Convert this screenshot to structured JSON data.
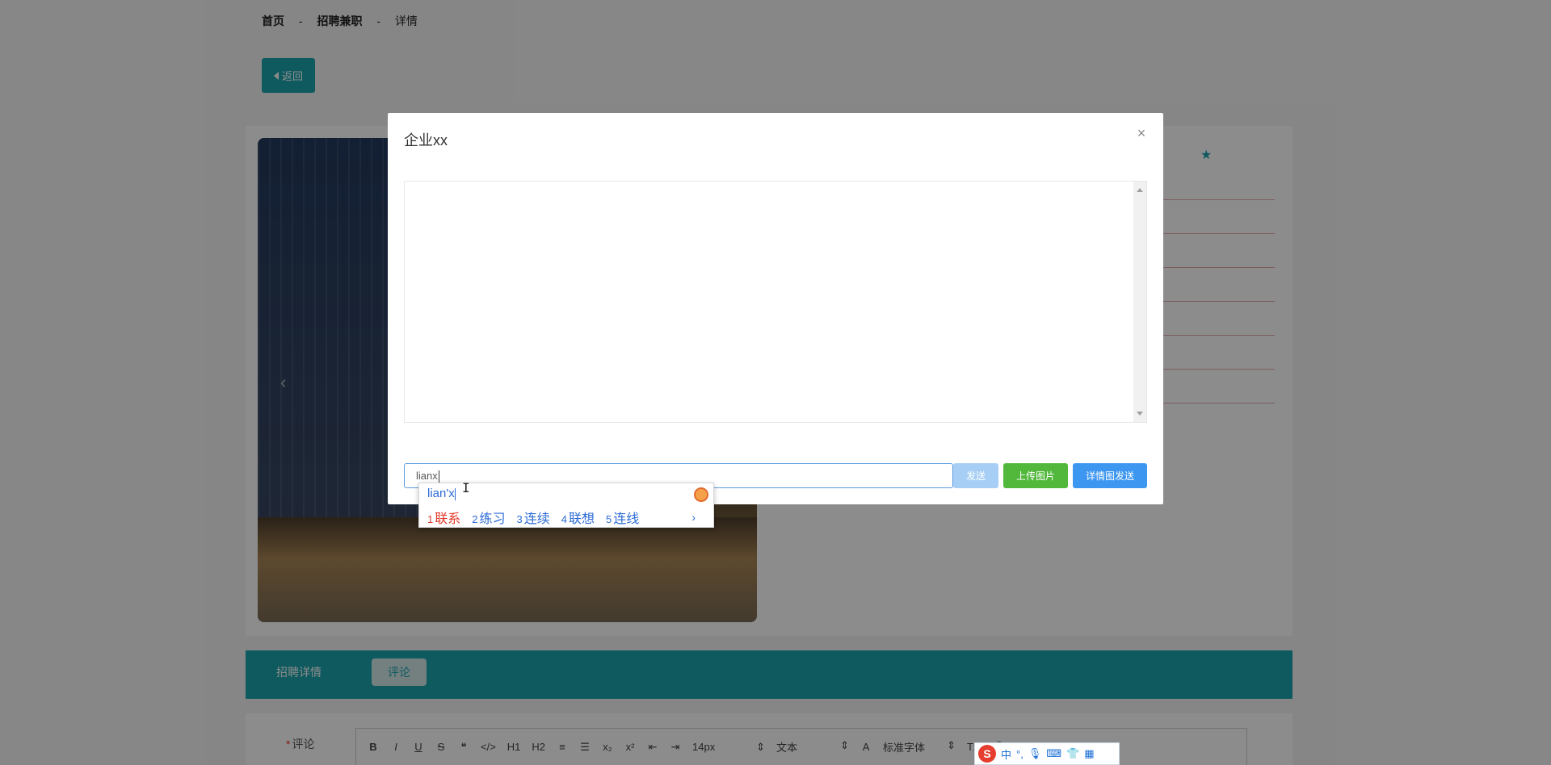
{
  "breadcrumb": {
    "home": "首页",
    "sep1": "-",
    "section": "招聘兼职",
    "sep2": "-",
    "current": "详情"
  },
  "back_button": {
    "label": "返回"
  },
  "tabs": [
    {
      "label": "招聘详情"
    },
    {
      "label": "评论"
    }
  ],
  "comment": {
    "required_mark": "*",
    "label": "评论"
  },
  "editor_toolbar": {
    "bold": "B",
    "italic": "I",
    "underline": "U",
    "strike": "S",
    "quote": "❝",
    "code": "</>",
    "h1": "H1",
    "h2": "H2",
    "ordered_list": "≡",
    "bullet_list": "☰",
    "subscript": "x₂",
    "superscript": "x²",
    "outdent": "⇤",
    "indent": "⇥",
    "font_size": "14px",
    "paragraph": "文本",
    "font_family": "标准字体",
    "clear_format": "Tx"
  },
  "modal": {
    "title": "企业xx",
    "close_icon": "×",
    "input_value": "lianx",
    "send_label": "发送",
    "upload_label": "上传图片",
    "detail_send_label": "详情图发送"
  },
  "ime": {
    "composition": "lian'x",
    "candidates": [
      {
        "num": "1",
        "text": "联系"
      },
      {
        "num": "2",
        "text": "练习"
      },
      {
        "num": "3",
        "text": "连续"
      },
      {
        "num": "4",
        "text": "联想"
      },
      {
        "num": "5",
        "text": "连线"
      }
    ],
    "next": "›"
  },
  "ime_status": {
    "logo": "S",
    "mode": "中",
    "punct": "°,",
    "mic": "🎤",
    "keyboard": "⌨",
    "skin": "👕",
    "grid": "▦"
  },
  "colors": {
    "accent": "#1aa5ad",
    "send_disabled": "#a7cff5",
    "upload": "#52b83c",
    "detail_send": "#3d97f0"
  }
}
